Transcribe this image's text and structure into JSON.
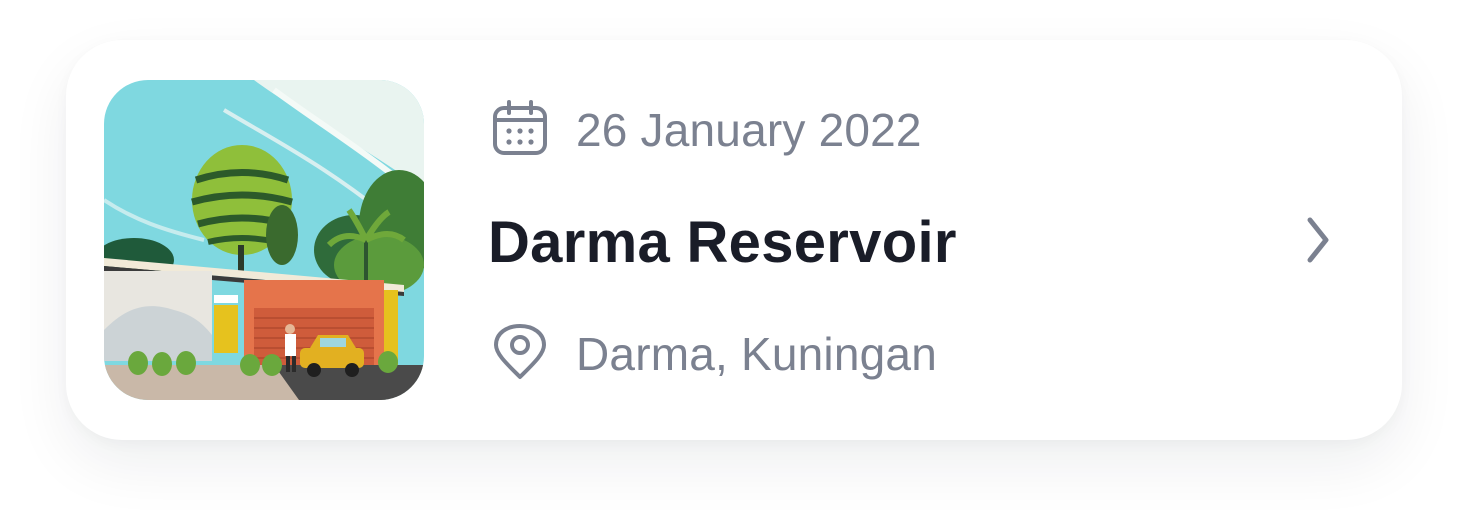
{
  "event_card": {
    "date": "26 January 2022",
    "title": "Darma Reservoir",
    "location": "Darma, Kuningan"
  },
  "icons": {
    "date": "calendar-icon",
    "location": "map-pin-icon",
    "action": "chevron-right-icon"
  },
  "colors": {
    "title": "#1a1d28",
    "meta_text": "#7b8190",
    "card_background": "#ffffff"
  }
}
